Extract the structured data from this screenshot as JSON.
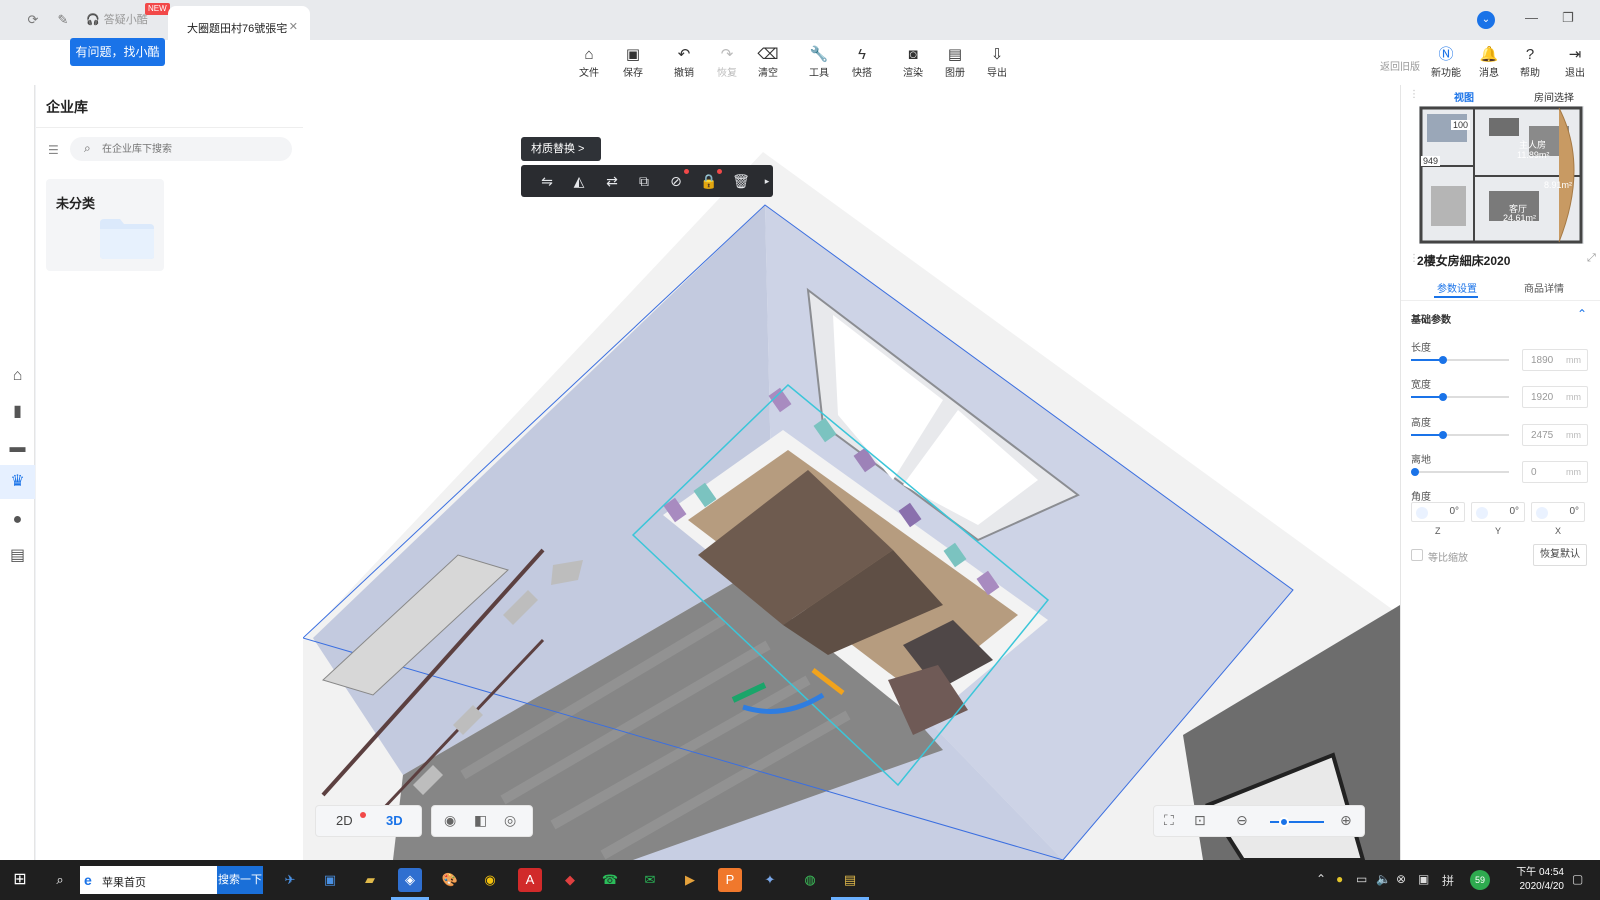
{
  "browser": {
    "inactive_tab": "答疑小酷",
    "new_badge": "NEW",
    "active_tab": "大圈题田村76號張宅",
    "help_chip": "有问题，找小酷"
  },
  "toolbar": {
    "items": [
      {
        "label": "文件",
        "icon": "home-icon"
      },
      {
        "label": "保存",
        "icon": "save-icon"
      },
      {
        "label": "撤销",
        "icon": "undo-icon"
      },
      {
        "label": "恢复",
        "icon": "redo-icon"
      },
      {
        "label": "清空",
        "icon": "eraser-icon"
      },
      {
        "label": "工具",
        "icon": "wrench-icon"
      },
      {
        "label": "快搭",
        "icon": "bolt-icon"
      },
      {
        "label": "渲染",
        "icon": "camera-icon"
      },
      {
        "label": "图册",
        "icon": "album-icon"
      },
      {
        "label": "导出",
        "icon": "export-icon"
      }
    ],
    "old_version": "返回旧版",
    "right_items": [
      {
        "label": "新功能",
        "icon": "new-icon"
      },
      {
        "label": "消息",
        "icon": "bell-icon"
      },
      {
        "label": "帮助",
        "icon": "help-icon"
      },
      {
        "label": "退出",
        "icon": "logout-icon"
      }
    ]
  },
  "library": {
    "title": "企业库",
    "search_placeholder": "在企业库下搜索",
    "folder_label": "未分类"
  },
  "viewport": {
    "material_chip": "材质替换 >",
    "mode_2d": "2D",
    "mode_3d": "3D"
  },
  "right_panel": {
    "tab_view": "视图",
    "tab_room": "房间选择",
    "thumb_labels": {
      "a": "100",
      "b": "949",
      "c": "主人房",
      "d": "11.89m²",
      "e": "客厅",
      "f": "24.61m²",
      "g": "8.91m²"
    },
    "product_title": "2樓女房細床2020",
    "subtab_params": "参数设置",
    "subtab_details": "商品详情",
    "section": "基础参数",
    "params": [
      {
        "label": "长度",
        "value": "1890",
        "unit": "mm",
        "level": 0.33
      },
      {
        "label": "宽度",
        "value": "1920",
        "unit": "mm",
        "level": 0.33
      },
      {
        "label": "高度",
        "value": "2475",
        "unit": "mm",
        "level": 0.33
      },
      {
        "label": "离地",
        "value": "0",
        "unit": "mm",
        "level": 0
      }
    ],
    "angle_label": "角度",
    "angles": [
      {
        "axis": "Z",
        "value": "0°"
      },
      {
        "axis": "Y",
        "value": "0°"
      },
      {
        "axis": "X",
        "value": "0°"
      }
    ],
    "proportional": "等比缩放",
    "reset": "恢复默认"
  },
  "taskbar": {
    "address_text": "苹果首页",
    "go_button": "搜索一下",
    "time": "下午 04:54",
    "date": "2020/4/20",
    "tray_badge": "59"
  },
  "colors": {
    "accent": "#1a73e8",
    "wall": "#c5cde0",
    "floor_wood": "#8a8886",
    "bed": "#b49a7d",
    "duvet": "#6d5a4d"
  }
}
